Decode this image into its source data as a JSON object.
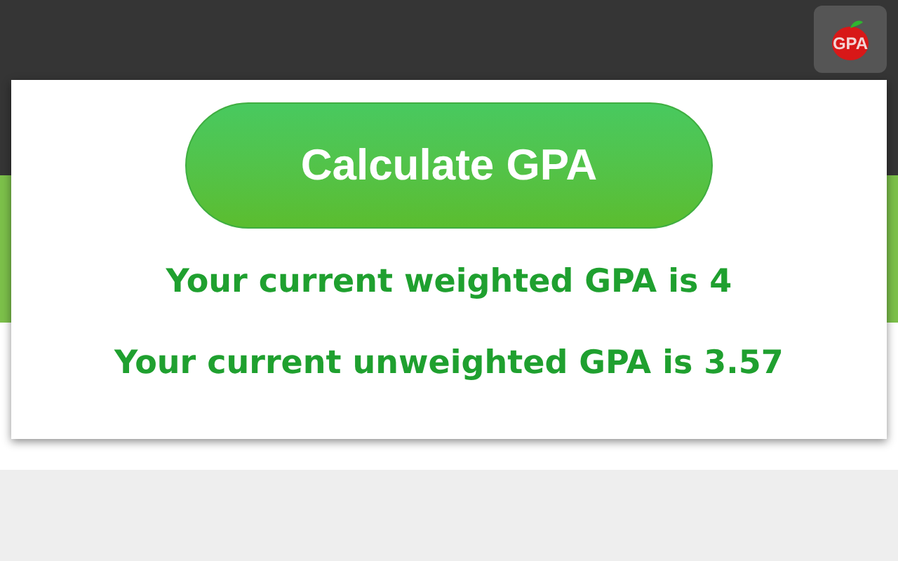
{
  "toolbar": {
    "extension_label": "GPA"
  },
  "popup": {
    "button": "Calculate GPA",
    "results": [
      "Your current weighted GPA is 4",
      "Your current unweighted GPA is 3.57"
    ]
  }
}
